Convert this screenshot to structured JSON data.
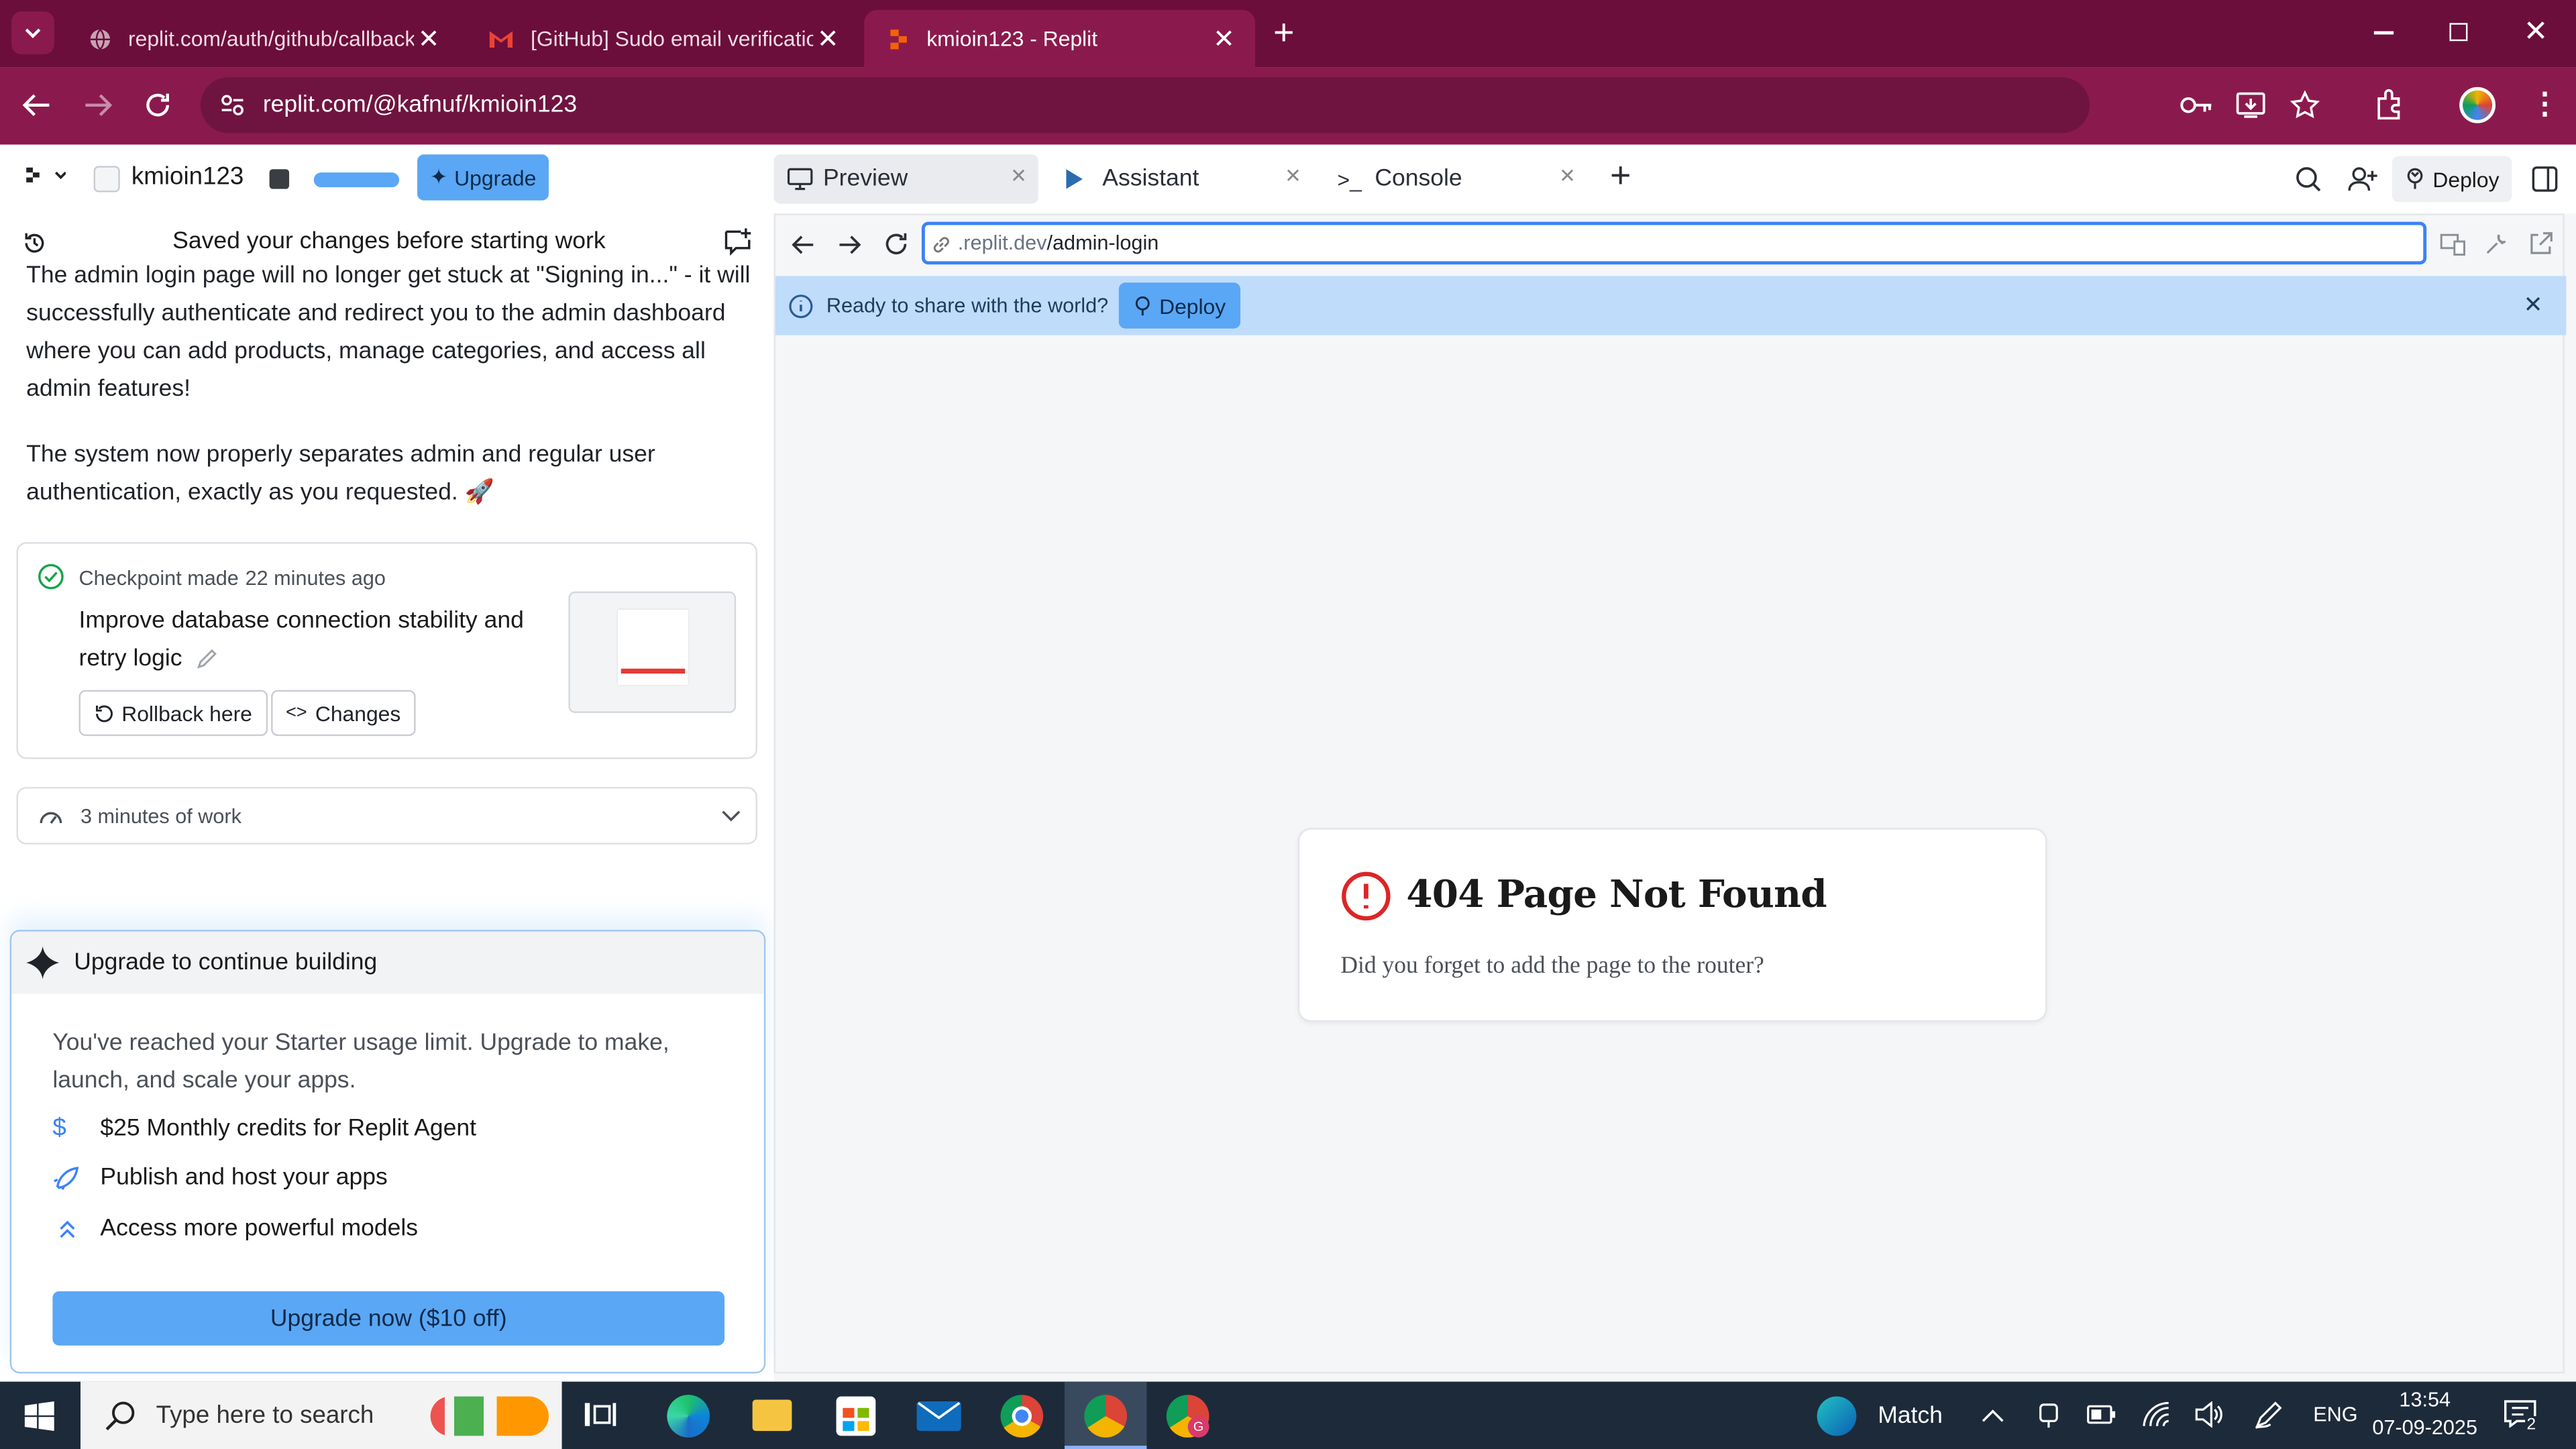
{
  "browser": {
    "tabs": [
      {
        "title": "replit.com/auth/github/callback"
      },
      {
        "title": "[GitHub] Sudo email verification"
      },
      {
        "title": "kmioin123 - Replit"
      }
    ],
    "url": "replit.com/@kafnuf/kmioin123"
  },
  "header": {
    "project_name": "kmioin123",
    "upgrade_label": "Upgrade"
  },
  "agent": {
    "saved_status": "Saved your changes before starting work",
    "message_p1": "The admin login page will no longer get stuck at \"Signing in...\" - it will successfully authenticate and redirect you to the admin dashboard where you can add products, manage categories, and access all admin features!",
    "message_p2": "The system now properly separates admin and regular user authentication, exactly as you requested. 🚀",
    "checkpoint_label": "Checkpoint made",
    "checkpoint_time": "22 minutes ago",
    "checkpoint_title": "Improve database connection stability and retry logic",
    "rollback_label": "Rollback here",
    "changes_label": "Changes",
    "work_summary": "3 minutes of work"
  },
  "upgrade_panel": {
    "title": "Upgrade to continue building",
    "description": "You've reached your Starter usage limit. Upgrade to make, launch, and scale your apps.",
    "features": [
      {
        "icon": "dollar-icon",
        "label": "$25 Monthly credits for Replit Agent"
      },
      {
        "icon": "rocket-icon",
        "label": "Publish and host your apps"
      },
      {
        "icon": "chevrons-up-icon",
        "label": "Access more powerful models"
      }
    ],
    "cta_label": "Upgrade now ($10 off)"
  },
  "workspace_tabs": [
    {
      "label": "Preview"
    },
    {
      "label": "Assistant"
    },
    {
      "label": "Console"
    }
  ],
  "deploy_label": "Deploy",
  "preview": {
    "url_prefix": ".replit.dev",
    "url_path": "/admin-login",
    "banner_text": "Ready to share with the world?",
    "banner_button": "Deploy",
    "error_title": "404 Page Not Found",
    "error_message": "Did you forget to add the page to the router?"
  },
  "taskbar": {
    "search_placeholder": "Type here to search",
    "weather_label": "Match",
    "language": "ENG",
    "time": "13:54",
    "date": "07-09-2025",
    "notification_count": "2"
  },
  "colors": {
    "tabstrip": "#6b0e3b",
    "toolbar": "#8a1a4d",
    "upgrade_button": "#5aa7f5",
    "banner": "#bfdcfb",
    "error_red": "#dc2626",
    "taskbar": "#1d2a3a"
  }
}
